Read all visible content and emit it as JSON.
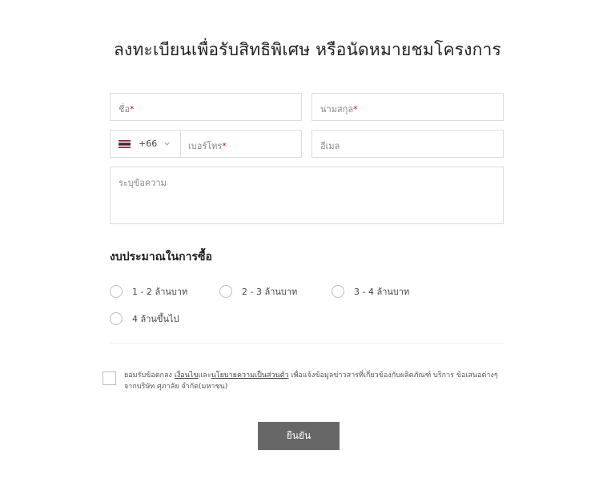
{
  "form": {
    "title": "ลงทะเบียนเพื่อรับสิทธิพิเศษ หรือนัดหมายชมโครงการ",
    "first_name_placeholder": "ชื่อ",
    "last_name_placeholder": "นามสกุล",
    "required_mark": "*",
    "country_code": "+66",
    "phone_placeholder": "เบอร์โทร",
    "email_placeholder": "อีเมล",
    "message_placeholder": "ระบุข้อความ",
    "budget_title": "งบประมาณในการซื้อ",
    "budget_options": [
      "1 - 2 ล้านบาท",
      "2 - 3 ล้านบาท",
      "3 - 4 ล้านบาท",
      "4 ล้านขึ้นไป"
    ],
    "consent": {
      "prefix": "ยอมรับข้อตกลง ",
      "terms_link": "เงื่อนไข",
      "and": "และ",
      "privacy_link": "นโยบายความเป็นส่วนตัว",
      "suffix": " เพื่อแจ้งข้อมูลข่าวสารที่เกี่ยวข้องกับผลิตภัณฑ์ บริการ ข้อเสนอต่างๆ จากบริษัท ศุภาลัย จำกัด(มหาชน)"
    },
    "submit_label": "ยืนยัน"
  },
  "icons": {
    "flag": "thailand-flag-icon",
    "chevron": "chevron-down-icon"
  }
}
